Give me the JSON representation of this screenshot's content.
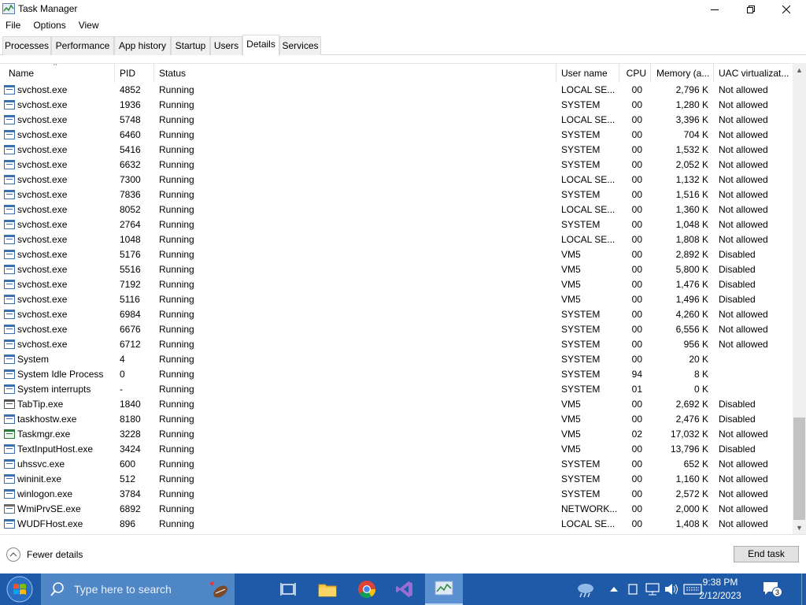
{
  "window": {
    "title": "Task Manager"
  },
  "menu": [
    "File",
    "Options",
    "View"
  ],
  "tabs": [
    "Processes",
    "Performance",
    "App history",
    "Startup",
    "Users",
    "Details",
    "Services"
  ],
  "active_tab": "Details",
  "columns": {
    "name": "Name",
    "pid": "PID",
    "status": "Status",
    "user": "User name",
    "cpu": "CPU",
    "memory": "Memory (a...",
    "uac": "UAC virtualizat..."
  },
  "rows": [
    {
      "name": "svchost.exe",
      "pid": "4852",
      "status": "Running",
      "user": "LOCAL SE...",
      "cpu": "00",
      "memory": "2,796 K",
      "uac": "Not allowed",
      "icon": "app-window-icon"
    },
    {
      "name": "svchost.exe",
      "pid": "1936",
      "status": "Running",
      "user": "SYSTEM",
      "cpu": "00",
      "memory": "1,280 K",
      "uac": "Not allowed",
      "icon": "app-window-icon"
    },
    {
      "name": "svchost.exe",
      "pid": "5748",
      "status": "Running",
      "user": "LOCAL SE...",
      "cpu": "00",
      "memory": "3,396 K",
      "uac": "Not allowed",
      "icon": "app-window-icon"
    },
    {
      "name": "svchost.exe",
      "pid": "6460",
      "status": "Running",
      "user": "SYSTEM",
      "cpu": "00",
      "memory": "704 K",
      "uac": "Not allowed",
      "icon": "app-window-icon"
    },
    {
      "name": "svchost.exe",
      "pid": "5416",
      "status": "Running",
      "user": "SYSTEM",
      "cpu": "00",
      "memory": "1,532 K",
      "uac": "Not allowed",
      "icon": "app-window-icon"
    },
    {
      "name": "svchost.exe",
      "pid": "6632",
      "status": "Running",
      "user": "SYSTEM",
      "cpu": "00",
      "memory": "2,052 K",
      "uac": "Not allowed",
      "icon": "app-window-icon"
    },
    {
      "name": "svchost.exe",
      "pid": "7300",
      "status": "Running",
      "user": "LOCAL SE...",
      "cpu": "00",
      "memory": "1,132 K",
      "uac": "Not allowed",
      "icon": "app-window-icon"
    },
    {
      "name": "svchost.exe",
      "pid": "7836",
      "status": "Running",
      "user": "SYSTEM",
      "cpu": "00",
      "memory": "1,516 K",
      "uac": "Not allowed",
      "icon": "app-window-icon"
    },
    {
      "name": "svchost.exe",
      "pid": "8052",
      "status": "Running",
      "user": "LOCAL SE...",
      "cpu": "00",
      "memory": "1,360 K",
      "uac": "Not allowed",
      "icon": "app-window-icon"
    },
    {
      "name": "svchost.exe",
      "pid": "2764",
      "status": "Running",
      "user": "SYSTEM",
      "cpu": "00",
      "memory": "1,048 K",
      "uac": "Not allowed",
      "icon": "app-window-icon"
    },
    {
      "name": "svchost.exe",
      "pid": "1048",
      "status": "Running",
      "user": "LOCAL SE...",
      "cpu": "00",
      "memory": "1,808 K",
      "uac": "Not allowed",
      "icon": "app-window-icon"
    },
    {
      "name": "svchost.exe",
      "pid": "5176",
      "status": "Running",
      "user": "VM5",
      "cpu": "00",
      "memory": "2,892 K",
      "uac": "Disabled",
      "icon": "app-window-icon"
    },
    {
      "name": "svchost.exe",
      "pid": "5516",
      "status": "Running",
      "user": "VM5",
      "cpu": "00",
      "memory": "5,800 K",
      "uac": "Disabled",
      "icon": "app-window-icon"
    },
    {
      "name": "svchost.exe",
      "pid": "7192",
      "status": "Running",
      "user": "VM5",
      "cpu": "00",
      "memory": "1,476 K",
      "uac": "Disabled",
      "icon": "app-window-icon"
    },
    {
      "name": "svchost.exe",
      "pid": "5116",
      "status": "Running",
      "user": "VM5",
      "cpu": "00",
      "memory": "1,496 K",
      "uac": "Disabled",
      "icon": "app-window-icon"
    },
    {
      "name": "svchost.exe",
      "pid": "6984",
      "status": "Running",
      "user": "SYSTEM",
      "cpu": "00",
      "memory": "4,260 K",
      "uac": "Not allowed",
      "icon": "app-window-icon"
    },
    {
      "name": "svchost.exe",
      "pid": "6676",
      "status": "Running",
      "user": "SYSTEM",
      "cpu": "00",
      "memory": "6,556 K",
      "uac": "Not allowed",
      "icon": "app-window-icon"
    },
    {
      "name": "svchost.exe",
      "pid": "6712",
      "status": "Running",
      "user": "SYSTEM",
      "cpu": "00",
      "memory": "956 K",
      "uac": "Not allowed",
      "icon": "app-window-icon"
    },
    {
      "name": "System",
      "pid": "4",
      "status": "Running",
      "user": "SYSTEM",
      "cpu": "00",
      "memory": "20 K",
      "uac": "",
      "icon": "app-window-icon"
    },
    {
      "name": "System Idle Process",
      "pid": "0",
      "status": "Running",
      "user": "SYSTEM",
      "cpu": "94",
      "memory": "8 K",
      "uac": "",
      "icon": "app-window-icon"
    },
    {
      "name": "System interrupts",
      "pid": "-",
      "status": "Running",
      "user": "SYSTEM",
      "cpu": "01",
      "memory": "0 K",
      "uac": "",
      "icon": "app-window-icon"
    },
    {
      "name": "TabTip.exe",
      "pid": "1840",
      "status": "Running",
      "user": "VM5",
      "cpu": "00",
      "memory": "2,692 K",
      "uac": "Disabled",
      "icon": "keyboard-icon"
    },
    {
      "name": "taskhostw.exe",
      "pid": "8180",
      "status": "Running",
      "user": "VM5",
      "cpu": "00",
      "memory": "2,476 K",
      "uac": "Disabled",
      "icon": "app-window-icon"
    },
    {
      "name": "Taskmgr.exe",
      "pid": "3228",
      "status": "Running",
      "user": "VM5",
      "cpu": "02",
      "memory": "17,032 K",
      "uac": "Not allowed",
      "icon": "task-manager-icon"
    },
    {
      "name": "TextInputHost.exe",
      "pid": "3424",
      "status": "Running",
      "user": "VM5",
      "cpu": "00",
      "memory": "13,796 K",
      "uac": "Disabled",
      "icon": "app-window-icon"
    },
    {
      "name": "uhssvc.exe",
      "pid": "600",
      "status": "Running",
      "user": "SYSTEM",
      "cpu": "00",
      "memory": "652 K",
      "uac": "Not allowed",
      "icon": "app-window-icon"
    },
    {
      "name": "wininit.exe",
      "pid": "512",
      "status": "Running",
      "user": "SYSTEM",
      "cpu": "00",
      "memory": "1,160 K",
      "uac": "Not allowed",
      "icon": "app-window-icon"
    },
    {
      "name": "winlogon.exe",
      "pid": "3784",
      "status": "Running",
      "user": "SYSTEM",
      "cpu": "00",
      "memory": "2,572 K",
      "uac": "Not allowed",
      "icon": "app-window-icon"
    },
    {
      "name": "WmiPrvSE.exe",
      "pid": "6892",
      "status": "Running",
      "user": "NETWORK...",
      "cpu": "00",
      "memory": "2,000 K",
      "uac": "Not allowed",
      "icon": "gear-icon"
    },
    {
      "name": "WUDFHost.exe",
      "pid": "896",
      "status": "Running",
      "user": "LOCAL SE...",
      "cpu": "00",
      "memory": "1,408 K",
      "uac": "Not allowed",
      "icon": "app-window-icon"
    }
  ],
  "footer": {
    "fewer_details": "Fewer details",
    "end_task": "End task"
  },
  "taskbar": {
    "search_placeholder": "Type here to search",
    "time": "9:38 PM",
    "date": "2/12/2023",
    "notification_count": "3"
  }
}
